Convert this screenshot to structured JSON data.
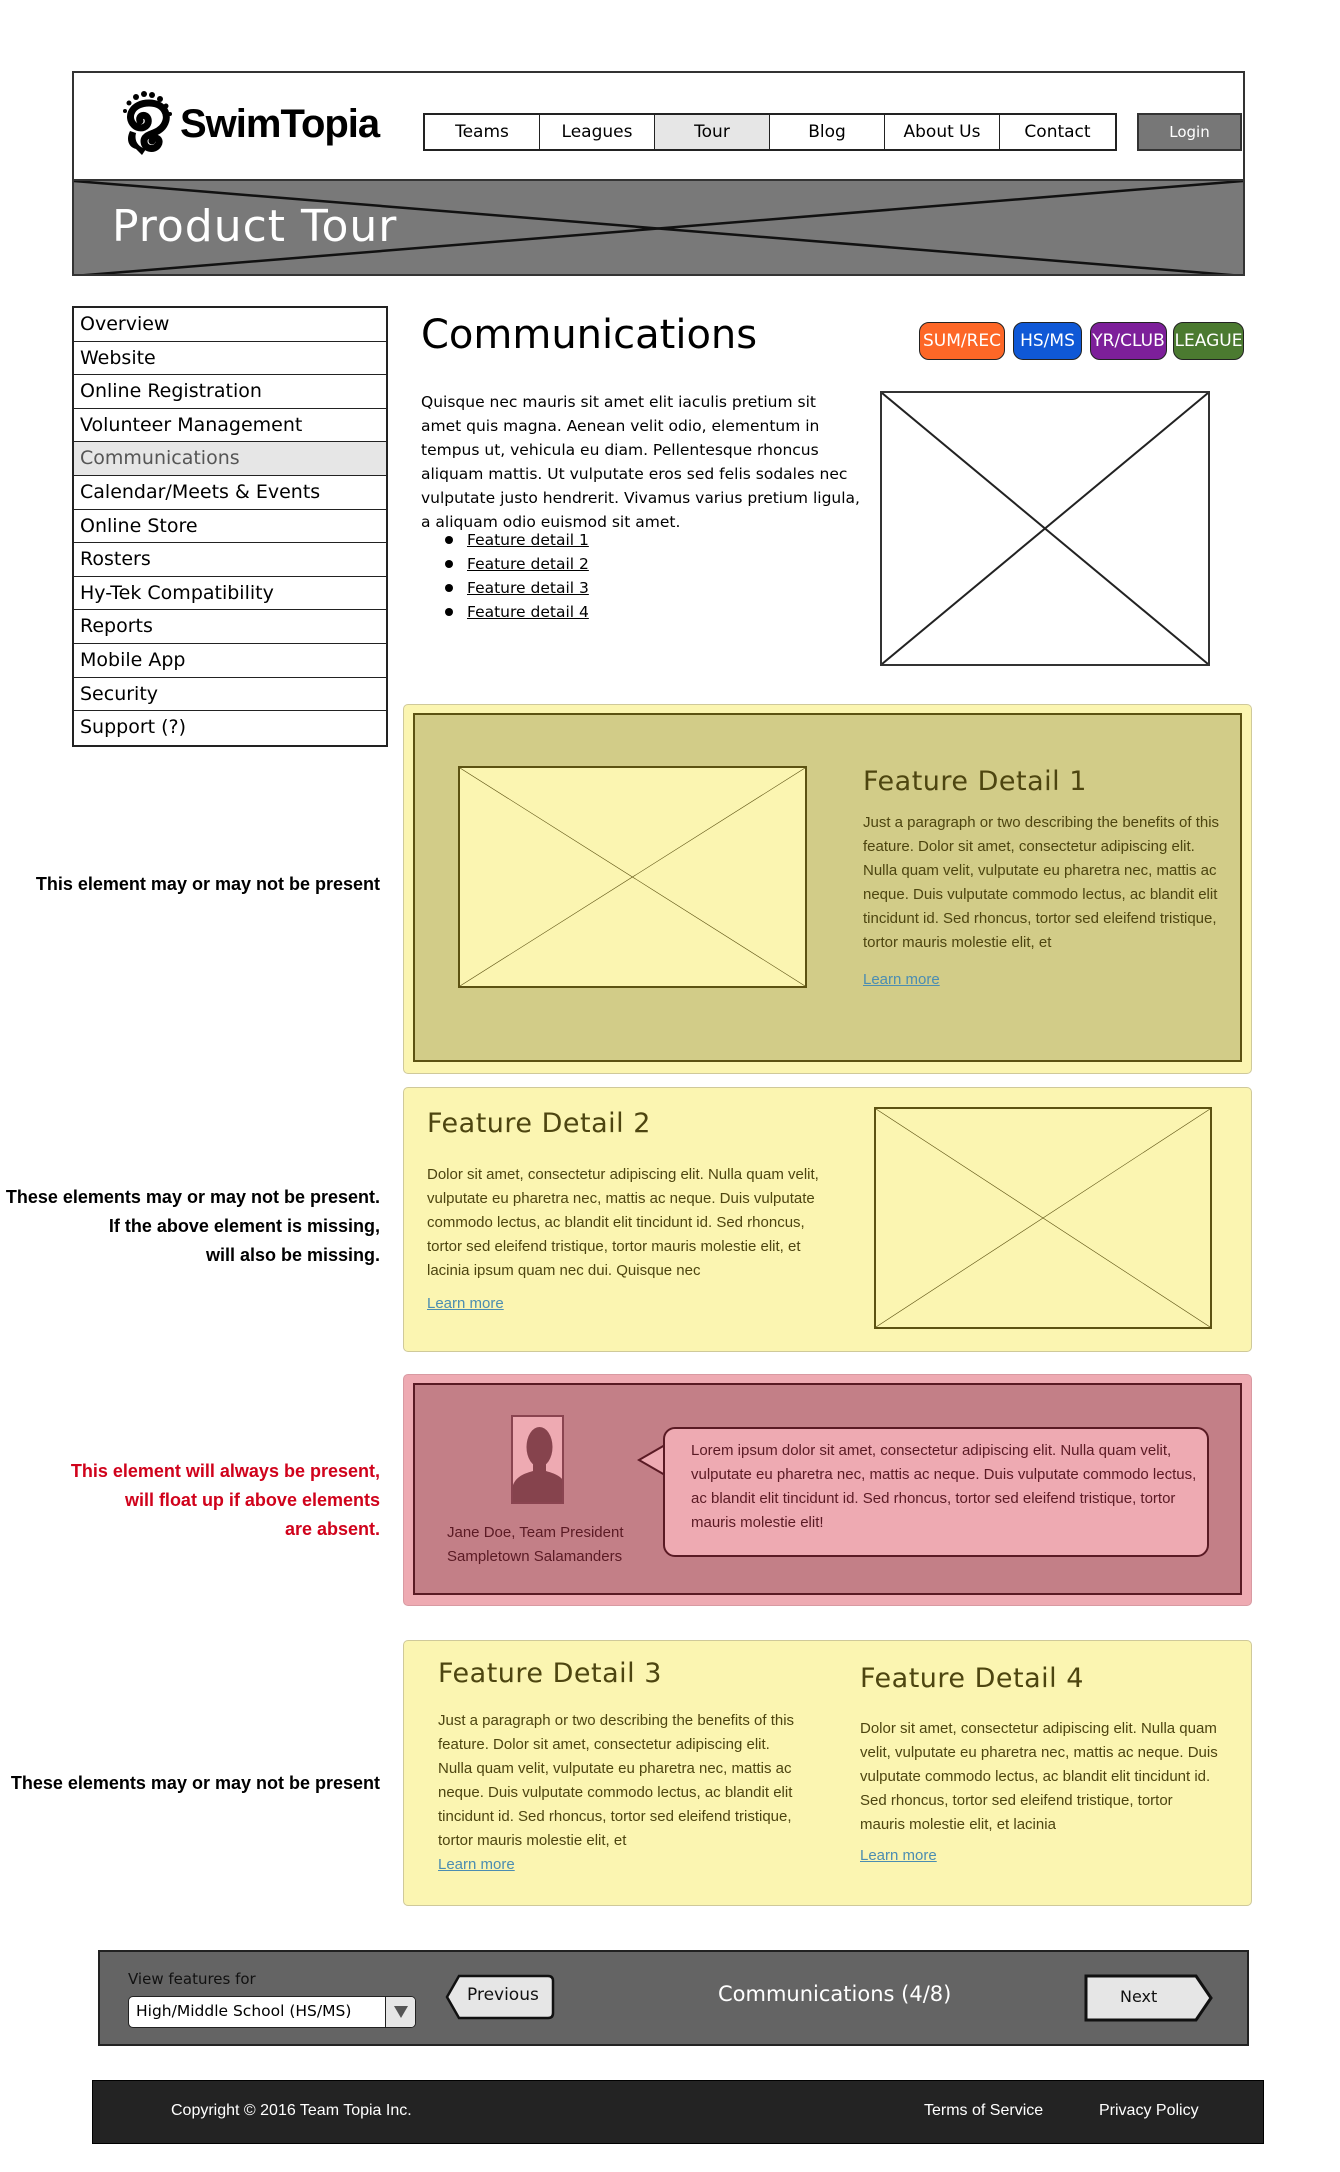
{
  "header": {
    "logo_text": "SwimTopia",
    "nav": [
      {
        "label": "Teams",
        "active": false
      },
      {
        "label": "Leagues",
        "active": false
      },
      {
        "label": "Tour",
        "active": true
      },
      {
        "label": "Blog",
        "active": false
      },
      {
        "label": "About Us",
        "active": false
      },
      {
        "label": "Contact",
        "active": false
      }
    ],
    "login_label": "Login",
    "banner_title": "Product Tour"
  },
  "sidebar": {
    "items": [
      {
        "label": "Overview",
        "active": false
      },
      {
        "label": "Website",
        "active": false
      },
      {
        "label": "Online Registration",
        "active": false
      },
      {
        "label": "Volunteer Management",
        "active": false
      },
      {
        "label": "Communications",
        "active": true
      },
      {
        "label": "Calendar/Meets & Events",
        "active": false
      },
      {
        "label": "Online Store",
        "active": false
      },
      {
        "label": "Rosters",
        "active": false
      },
      {
        "label": "Hy-Tek Compatibility",
        "active": false
      },
      {
        "label": "Reports",
        "active": false
      },
      {
        "label": "Mobile App",
        "active": false
      },
      {
        "label": "Security",
        "active": false
      },
      {
        "label": "Support (?)",
        "active": false
      }
    ]
  },
  "main": {
    "title": "Communications",
    "badges": [
      {
        "label": "SUM/REC",
        "color": "#fd6727"
      },
      {
        "label": "HS/MS",
        "color": "#0f58d6"
      },
      {
        "label": "YR/CLUB",
        "color": "#7d1f9a"
      },
      {
        "label": "LEAGUE",
        "color": "#4b7a30"
      }
    ],
    "intro": "Quisque nec mauris sit amet elit iaculis pretium sit amet quis magna. Aenean velit odio, elementum in tempus ut, vehicula eu diam. Pellentesque rhoncus aliquam mattis. Ut vulputate eros sed felis sodales nec vulputate justo hendrerit. Vivamus varius pretium ligula, a aliquam odio euismod sit amet.",
    "feature_links": [
      "Feature detail 1",
      "Feature detail 2",
      "Feature detail 3",
      "Feature detail 4"
    ]
  },
  "notes": {
    "feature1": "This element may or may not be present",
    "feature2": [
      "These elements may or may not be present.",
      "If the above element is missing,",
      "will also be missing."
    ],
    "testimonial": [
      "This element will always be present,",
      "will float up if above elements",
      "are absent."
    ],
    "feature34": "These elements may or may not be present"
  },
  "features": {
    "f1": {
      "title": "Feature Detail 1",
      "body": "Just a paragraph or two describing the benefits of this feature. Dolor sit amet, consectetur adipiscing elit. Nulla quam velit, vulputate eu pharetra nec, mattis ac neque. Duis vulputate commodo lectus, ac blandit elit tincidunt id. Sed rhoncus, tortor sed eleifend tristique, tortor mauris molestie elit, et",
      "link": "Learn more"
    },
    "f2": {
      "title": "Feature Detail 2",
      "body": "Dolor sit amet, consectetur adipiscing elit. Nulla quam velit, vulputate eu pharetra nec, mattis ac neque. Duis vulputate commodo lectus, ac blandit elit tincidunt id. Sed rhoncus, tortor sed eleifend tristique, tortor mauris molestie elit, et lacinia ipsum quam nec dui. Quisque nec",
      "link": "Learn more"
    },
    "f3": {
      "title": "Feature Detail 3",
      "body": "Just a paragraph or two describing the benefits of this feature. Dolor sit amet, consectetur adipiscing elit. Nulla quam velit, vulputate eu pharetra nec, mattis ac neque. Duis vulputate commodo lectus, ac blandit elit tincidunt id. Sed rhoncus, tortor sed eleifend tristique, tortor mauris molestie elit, et",
      "link": "Learn more"
    },
    "f4": {
      "title": "Feature Detail 4",
      "body": "Dolor sit amet, consectetur adipiscing elit. Nulla quam velit, vulputate eu pharetra nec, mattis ac neque. Duis vulputate commodo lectus, ac blandit elit tincidunt id. Sed rhoncus, tortor sed eleifend tristique, tortor mauris molestie elit, et lacinia",
      "link": "Learn more"
    }
  },
  "testimonial": {
    "name": "Jane Doe, Team President",
    "team": "Sampletown Salamanders",
    "quote": "Lorem ipsum dolor sit amet, consectetur adipiscing elit. Nulla quam velit, vulputate eu pharetra nec, mattis ac neque. Duis vulputate commodo lectus, ac blandit elit tincidunt id. Sed rhoncus, tortor sed eleifend tristique, tortor mauris molestie elit!"
  },
  "bottom_nav": {
    "view_label": "View features for",
    "selected": "High/Middle School (HS/MS)",
    "prev_label": "Previous",
    "next_label": "Next",
    "page_indicator": "Communications (4/8)"
  },
  "footer": {
    "copyright": "Copyright © 2016 Team Topia Inc.",
    "terms": "Terms of Service",
    "privacy": "Privacy Policy"
  }
}
